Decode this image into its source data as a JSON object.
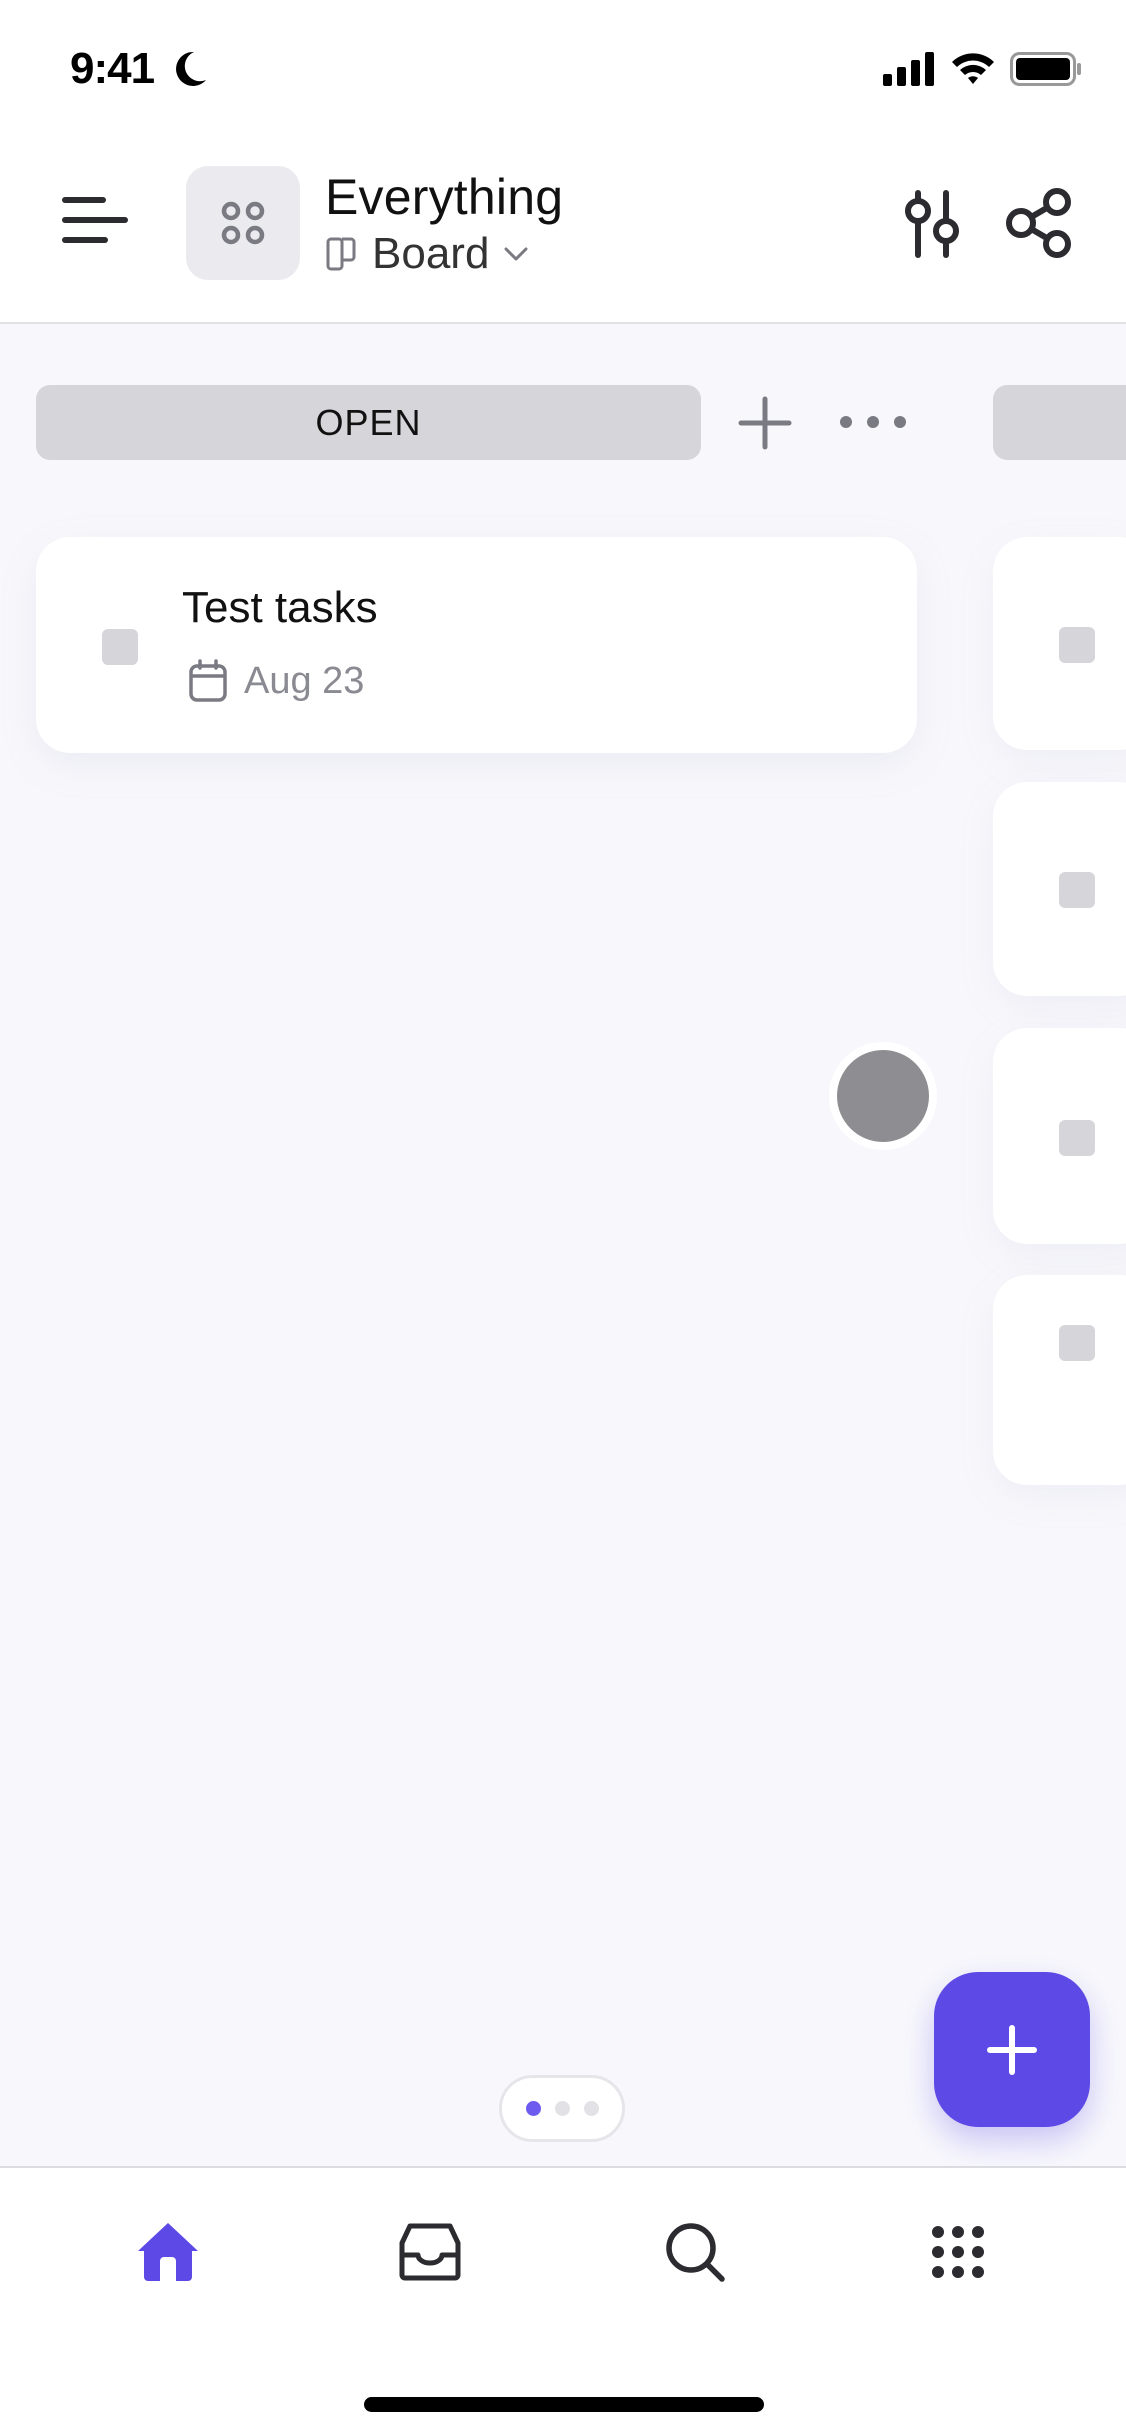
{
  "status_bar": {
    "time": "9:41",
    "icons": [
      "moon-icon",
      "signal-icon",
      "wifi-icon",
      "battery-icon"
    ]
  },
  "header": {
    "space_icon": "grid-dots-icon",
    "title": "Everything",
    "view_label": "Board",
    "view_icon": "board-icon",
    "actions": [
      "filter-sliders-icon",
      "share-icon"
    ]
  },
  "board": {
    "columns": [
      {
        "name": "OPEN",
        "tasks": [
          {
            "title": "Test tasks",
            "due_date": "Aug 23"
          }
        ]
      }
    ],
    "next_column_card_count": 4
  },
  "pager": {
    "pages": 3,
    "active_index": 0
  },
  "fab": {
    "icon": "plus-icon"
  },
  "bottom_nav": {
    "items": [
      {
        "name": "home",
        "icon": "home-icon",
        "active": true
      },
      {
        "name": "inbox",
        "icon": "inbox-icon",
        "active": false
      },
      {
        "name": "search",
        "icon": "search-icon",
        "active": false
      },
      {
        "name": "more",
        "icon": "apps-grid-icon",
        "active": false
      }
    ]
  },
  "colors": {
    "accent": "#5d4ae6",
    "background": "#f8f8fc",
    "pill": "#d6d5da",
    "muted_text": "#8a8a92"
  }
}
